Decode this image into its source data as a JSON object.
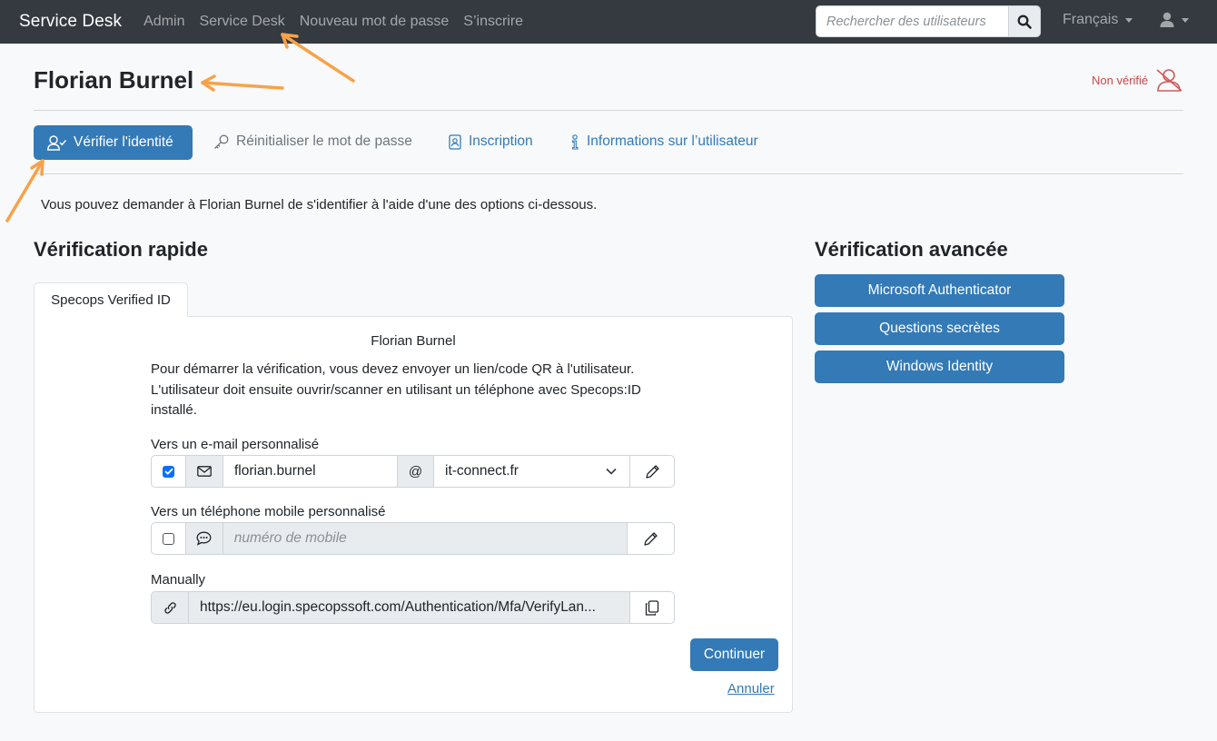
{
  "navbar": {
    "brand": "Service Desk",
    "links": [
      "Admin",
      "Service Desk",
      "Nouveau mot de passe",
      "S’inscrire"
    ],
    "search_placeholder": "Rechercher des utilisateurs",
    "language": "Français"
  },
  "header": {
    "title": "Florian Burnel",
    "status": "Non vérifié"
  },
  "tabs": {
    "verify": "Vérifier l'identité",
    "reset": "Réinitialiser le mot de passe",
    "enroll": "Inscription",
    "info": "Informations sur l’utilisateur"
  },
  "intro": "Vous pouvez demander à Florian Burnel de s'identifier à l'aide d'une des options ci-dessous.",
  "quick": {
    "heading": "Vérification rapide",
    "tab": "Specops Verified ID",
    "name": "Florian Burnel",
    "description": "Pour démarrer la vérification, vous devez envoyer un lien/code QR à l'utilisateur. L'utilisateur doit ensuite ouvrir/scanner en utilisant un téléphone avec Specops:ID installé.",
    "email_label": "Vers un e-mail personnalisé",
    "email_user": "florian.burnel",
    "at": "@",
    "email_domain": "it-connect.fr",
    "phone_label": "Vers un téléphone mobile personnalisé",
    "phone_placeholder": "numéro de mobile",
    "manual_label": "Manually",
    "manual_url": "https://eu.login.specopssoft.com/Authentication/Mfa/VerifyLan...",
    "continue": "Continuer",
    "cancel": "Annuler"
  },
  "advanced": {
    "heading": "Vérification avancée",
    "buttons": [
      "Microsoft Authenticator",
      "Questions secrètes",
      "Windows Identity"
    ]
  },
  "colors": {
    "navbar": "#343a40",
    "primary": "#337ab7",
    "danger": "#c9494a",
    "annotation": "#f7a24a"
  }
}
